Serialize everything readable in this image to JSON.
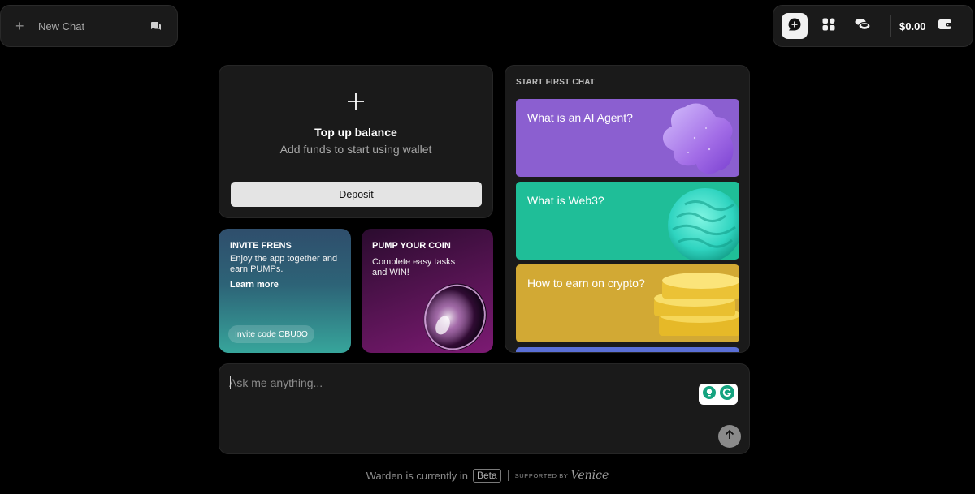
{
  "new_chat": {
    "label": "New Chat"
  },
  "toolbar": {
    "balance": "$0.00",
    "buttons": [
      "chat-icon",
      "apps-icon",
      "coins-icon",
      "wallet-icon"
    ]
  },
  "topup": {
    "title": "Top up balance",
    "subtitle": "Add funds to start using wallet",
    "deposit_label": "Deposit"
  },
  "invite": {
    "heading": "INVITE FRENS",
    "description": "Enjoy the app together and earn PUMPs.",
    "learn_more": "Learn more",
    "invite_code": "Invite code CBU0O"
  },
  "pump": {
    "heading": "PUMP YOUR COIN",
    "description": "Complete easy tasks and WIN!"
  },
  "start_chat": {
    "heading": "START FIRST CHAT",
    "topics": [
      {
        "label": "What is an AI Agent?",
        "color": "#8b5fd0"
      },
      {
        "label": "What is Web3?",
        "color": "#1fbe98"
      },
      {
        "label": "How to earn on crypto?",
        "color": "#d2a934"
      }
    ]
  },
  "ask": {
    "placeholder": "Ask me anything..."
  },
  "footer": {
    "status": "Warden is currently in",
    "badge": "Beta",
    "supported_by": "SUPPORTED BY",
    "partner": "Venice"
  },
  "colors": {
    "background": "#000000",
    "panel": "#1a1a1a",
    "accent_purple": "#8b5fd0",
    "accent_teal": "#1fbe98",
    "accent_gold": "#d2a934"
  }
}
